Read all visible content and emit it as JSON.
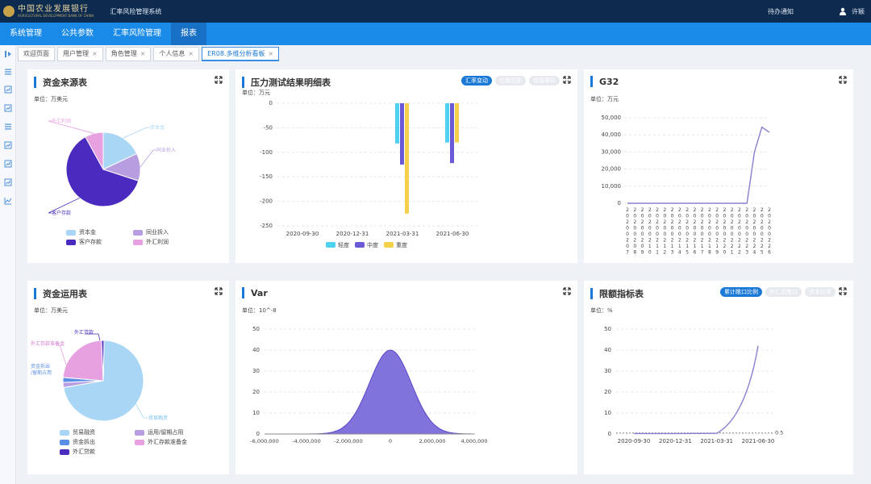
{
  "header": {
    "logo_cn": "中国农业发展银行",
    "logo_en": "AGRICULTURAL DEVELOPMENT BANK OF CHINA",
    "system_title": "汇率风险管理系统",
    "notice": "待办通知",
    "username": "许颖"
  },
  "nav": [
    {
      "label": "系统管理"
    },
    {
      "label": "公共参数"
    },
    {
      "label": "汇率风险管理"
    },
    {
      "label": "报表",
      "active": true
    }
  ],
  "tabs": [
    {
      "label": "欢迎页面",
      "closable": false
    },
    {
      "label": "用户管理",
      "closable": true
    },
    {
      "label": "角色管理",
      "closable": true
    },
    {
      "label": "个人信息",
      "closable": true
    },
    {
      "label": "ER08.多维分析看板",
      "closable": true,
      "active": true
    }
  ],
  "sidebar_icons": [
    "collapse-icon",
    "list-icon",
    "report-icon",
    "report-icon",
    "list-icon",
    "report-icon",
    "report-icon",
    "report-icon",
    "line-chart-icon"
  ],
  "colors": {
    "accent": "#1a78d6",
    "topbar": "#0d2a4f",
    "navbar": "#1a8ae8",
    "light_blue": "#a9d6f5",
    "purple": "#4b2bbf",
    "lavender": "#b89de0",
    "pink": "#e7a0e0",
    "cyan": "#4fd2f0",
    "mid_purple": "#6a5ad6",
    "yellow": "#f5d04a"
  },
  "panels": {
    "funding": {
      "title": "资金来源表",
      "unit": "单位：万美元"
    },
    "stress": {
      "title": "压力测试结果明细表",
      "unit": "单位：万元",
      "pills": [
        "汇率变动",
        "估值因素",
        "极端事件"
      ],
      "active_pill": 0
    },
    "g32": {
      "title": "G32",
      "unit": "单位：万元"
    },
    "usage": {
      "title": "资金运用表",
      "unit": "单位：万美元"
    },
    "var": {
      "title": "Var",
      "unit": "单位：10^-8"
    },
    "limit": {
      "title": "限额指标表",
      "unit": "单位：%",
      "pills": [
        "累计敞口比例",
        "外汇总敞口",
        "资本比率"
      ],
      "active_pill": 0
    }
  },
  "chart_data": [
    {
      "id": "funding",
      "type": "pie",
      "title": "资金来源表",
      "slices": [
        {
          "name": "资本金",
          "value": 18
        },
        {
          "name": "同业拆入",
          "value": 12
        },
        {
          "name": "客户存款",
          "value": 62
        },
        {
          "name": "外汇利润",
          "value": 8
        }
      ],
      "legend": [
        "资本金",
        "同业拆入",
        "客户存款",
        "外汇利润"
      ]
    },
    {
      "id": "stress",
      "type": "bar",
      "title": "压力测试结果明细表",
      "categories": [
        "2020-09-30",
        "2020-12-31",
        "2021-03-31",
        "2021-06-30"
      ],
      "series": [
        {
          "name": "轻度",
          "values": [
            0,
            0,
            -82,
            -80
          ]
        },
        {
          "name": "中度",
          "values": [
            0,
            0,
            -125,
            -122
          ]
        },
        {
          "name": "重度",
          "values": [
            0,
            0,
            -225,
            -80
          ]
        }
      ],
      "ylim": [
        -250,
        0
      ],
      "yticks": [
        0,
        -50,
        -100,
        -150,
        -200,
        -250
      ]
    },
    {
      "id": "g32",
      "type": "line",
      "title": "G32",
      "x": [
        "20200207",
        "20200208",
        "20200209",
        "20200210",
        "20200211",
        "20200212",
        "20200213",
        "20200214",
        "20200215",
        "20200216",
        "20200217",
        "20200218",
        "20200219",
        "20200220",
        "20200221",
        "20200222",
        "20200223",
        "20200224",
        "20200225",
        "20200226"
      ],
      "xticks": [
        "20200207",
        "20200208",
        "20200209",
        "20200210",
        "20200211",
        "20200212",
        "20200213",
        "20200214",
        "20200215",
        "20200216",
        "20200217",
        "20200218",
        "20200219",
        "20200220",
        "20200221",
        "20200222",
        "20200223",
        "20200224",
        "20200225",
        "20200226"
      ],
      "values": [
        0,
        0,
        0,
        0,
        0,
        0,
        0,
        0,
        0,
        0,
        0,
        0,
        0,
        0,
        0,
        0,
        0,
        30000,
        44500,
        41500
      ],
      "ylim": [
        0,
        50000
      ],
      "yticks": [
        "0",
        "10,000",
        "20,000",
        "30,000",
        "40,000",
        "50,000"
      ]
    },
    {
      "id": "usage",
      "type": "pie",
      "title": "资金运用表",
      "slices": [
        {
          "name": "贸易融资",
          "value": 72
        },
        {
          "name": "运用/留期占用",
          "value": 2
        },
        {
          "name": "资金拆出",
          "value": 2
        },
        {
          "name": "外汇存款准备金",
          "value": 23
        },
        {
          "name": "外汇贷款",
          "value": 1
        }
      ],
      "legend": [
        "贸易融资",
        "运用/留期占用",
        "资金拆出",
        "外汇存款准备金",
        "外汇贷款"
      ],
      "callouts": [
        "外汇贷款",
        "外汇存款准备金",
        "资金拆出\n/留期占用",
        "贸易融资"
      ]
    },
    {
      "id": "var",
      "type": "area",
      "title": "Var",
      "distribution": "normal",
      "mean": 0,
      "std": 1000000,
      "peak": 40,
      "xlim": [
        -6000000,
        4000000
      ],
      "xticks": [
        "-6,000,000",
        "-4,000,000",
        "-2,000,000",
        "0",
        "2,000,000",
        "4,000,000"
      ],
      "ylim": [
        0,
        50
      ],
      "yticks": [
        0,
        10,
        20,
        30,
        40,
        50
      ]
    },
    {
      "id": "limit",
      "type": "line",
      "title": "限额指标表",
      "x": [
        "2020-09-30",
        "2020-12-31",
        "2021-03-31",
        "2021-06-30"
      ],
      "threshold": 0.5,
      "threshold_label": "0.5",
      "values": [
        0.2,
        0.2,
        0.3,
        42
      ],
      "ylim": [
        0,
        50
      ],
      "yticks": [
        0,
        10,
        20,
        30,
        40,
        50
      ]
    }
  ]
}
